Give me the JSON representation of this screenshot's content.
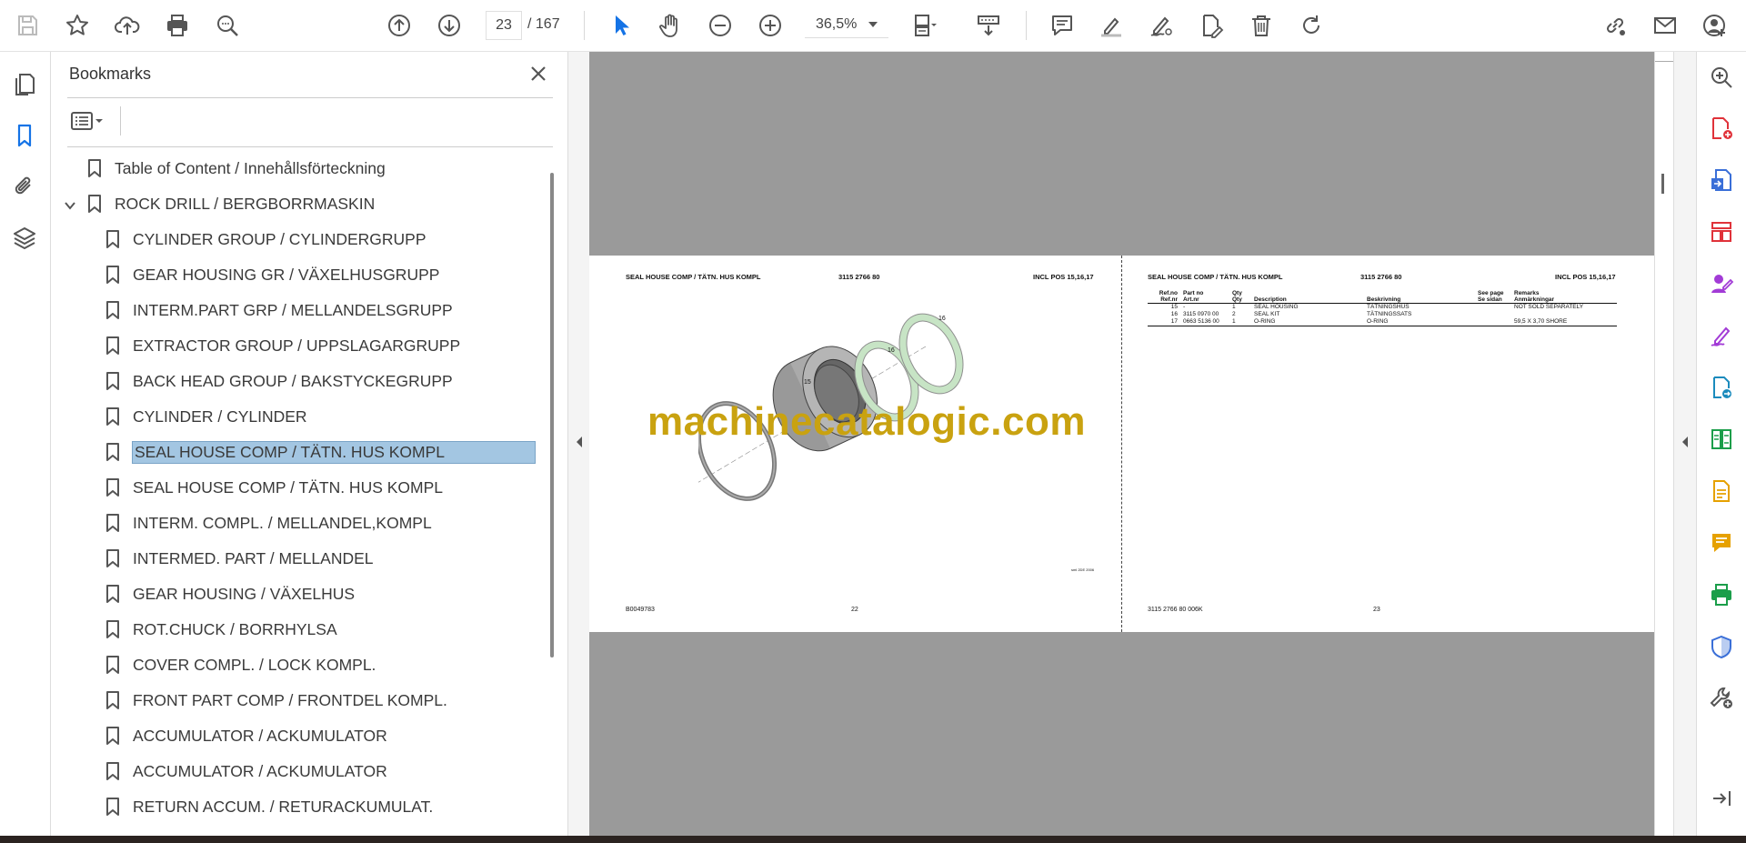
{
  "toolbar": {
    "page_current": "23",
    "page_total": "/ 167",
    "zoom": "36,5%"
  },
  "panel": {
    "title": "Bookmarks",
    "bookmarks": [
      {
        "label": "Table of Content / Innehållsförteckning"
      },
      {
        "label": "ROCK DRILL / BERGBORRMASKIN"
      },
      {
        "label": "CYLINDER GROUP / CYLINDERGRUPP"
      },
      {
        "label": "GEAR HOUSING GR  / VÄXELHUSGRUPP"
      },
      {
        "label": "INTERM.PART GRP  / MELLANDELSGRUPP"
      },
      {
        "label": "EXTRACTOR GROUP  / UPPSLAGARGRUPP"
      },
      {
        "label": "BACK HEAD GROUP  / BAKSTYCKEGRUPP"
      },
      {
        "label": "CYLINDER / CYLINDER"
      },
      {
        "label": "SEAL HOUSE COMP  / TÄTN. HUS KOMPL"
      },
      {
        "label": "SEAL HOUSE COMP  / TÄTN. HUS KOMPL"
      },
      {
        "label": "INTERM. COMPL. / MELLANDEL,KOMPL"
      },
      {
        "label": "INTERMED. PART / MELLANDEL"
      },
      {
        "label": "GEAR HOUSING / VÄXELHUS"
      },
      {
        "label": "ROT.CHUCK / BORRHYLSA"
      },
      {
        "label": "COVER COMPL. / LOCK KOMPL."
      },
      {
        "label": "FRONT PART COMP  / FRONTDEL KOMPL."
      },
      {
        "label": "ACCUMULATOR / ACKUMULATOR"
      },
      {
        "label": "ACCUMULATOR / ACKUMULATOR"
      },
      {
        "label": "RETURN ACCUM. / RETURACKUMULAT."
      }
    ]
  },
  "document": {
    "watermark": "machinecatalogic.com",
    "left_page": {
      "title": "SEAL HOUSE COMP / TÄTN. HUS KOMPL",
      "part_no": "3115 2766 80",
      "incl": "INCL POS 15,16,17",
      "callouts": [
        "15",
        "16",
        "16"
      ],
      "drawing_ref": "sml 2DE 2006",
      "footer_code": "B0049783",
      "page_number": "22"
    },
    "right_page": {
      "title": "SEAL HOUSE COMP / TÄTN. HUS KOMPL",
      "part_no": "3115 2766 80",
      "incl": "INCL POS 15,16,17",
      "footer_code": "3115 2766 80 006K",
      "page_number": "23",
      "columns": {
        "ref": [
          "Ref.no",
          "Ref.nr"
        ],
        "part": [
          "Part no",
          "Art.nr"
        ],
        "qty": [
          "Qty",
          "Qty"
        ],
        "desc": [
          "Description",
          ""
        ],
        "beskr": [
          "Beskrivning",
          ""
        ],
        "see": [
          "See page",
          "Se sidan"
        ],
        "remarks": [
          "Remarks",
          "Anmärkningar"
        ]
      },
      "rows": [
        {
          "ref": "15",
          "part": "-",
          "qty": "1",
          "desc": "SEAL HOUSING",
          "beskr": "TÄTNINGSHUS",
          "see": "",
          "remarks": "NOT SOLD SEPARATELY"
        },
        {
          "ref": "16",
          "part": "3115 0970 00",
          "qty": "2",
          "desc": "SEAL KIT",
          "beskr": "TÄTNINGSSATS",
          "see": "",
          "remarks": ""
        },
        {
          "ref": "17",
          "part": "0663 5136 00",
          "qty": "1",
          "desc": "O-RING",
          "beskr": "O-RING",
          "see": "",
          "remarks": "59,5 X 3,70 SHORE"
        }
      ]
    }
  }
}
